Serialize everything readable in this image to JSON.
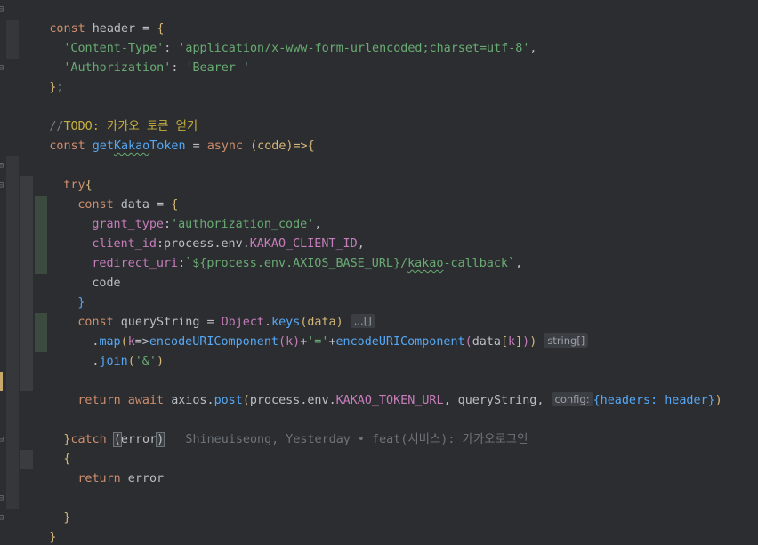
{
  "editor": {
    "lines": {
      "l1": {
        "kw": "const",
        "name": "header",
        "eq": " = ",
        "brace": "{"
      },
      "l2": {
        "key": "'Content-Type'",
        "colon": ": ",
        "val": "'application/x-www-form-urlencoded;charset=utf-8'",
        "comma": ","
      },
      "l3": {
        "key": "'Authorization'",
        "colon": ": ",
        "val": "'Bearer '"
      },
      "l4": {
        "brace": "}",
        "semi": ";"
      },
      "l6": {
        "slashes": "//",
        "todo": "TODO: 카카오 토큰 얻기"
      },
      "l7": {
        "kw": "const",
        "fname_a": "get",
        "fname_b": "Kakao",
        "fname_c": "Token",
        "eq": " = ",
        "async": "async",
        "params": "(code)=>{"
      },
      "l9": {
        "try": "try",
        "brace": "{"
      },
      "l10": {
        "kw": "const",
        "name": " data = ",
        "brace": "{"
      },
      "l11": {
        "key": "grant_type",
        "colon": ":",
        "val": "'authorization_code'",
        "comma": ","
      },
      "l12": {
        "key": "client_id",
        "colon": ":",
        "obj": "process",
        "dot1": ".",
        "env": "env",
        "dot2": ".",
        "constname": "KAKAO_CLIENT_ID",
        "comma": ","
      },
      "l13": {
        "key": "redirect_uri",
        "colon": ":",
        "tpl_open": "`${",
        "obj": "process",
        "dot1": ".",
        "env": "env",
        "dot2": ".",
        "constname": "AXIOS_BASE_URL",
        "tpl_close": "}",
        "slash": "/",
        "kakao": "kakao",
        "rest": "-callback`",
        "comma": ","
      },
      "l14": {
        "key": "code"
      },
      "l15": {
        "brace": "}"
      },
      "l16": {
        "kw": "const",
        "name": " queryString = ",
        "obj": "Object",
        "dot": ".",
        "fn": "keys",
        "args": "(data)",
        "hint": "...[]"
      },
      "l17": {
        "dot": ".",
        "fn": "map",
        "p1": "(",
        "k1": "k",
        "arrow": "=>",
        "enc1": "encodeURIComponent",
        "p2": "(",
        "k2": "k",
        "p3": ")",
        "plus1": "+",
        "eqstr": "'='",
        "plus2": "+",
        "enc2": "encodeURIComponent",
        "p4": "(",
        "data": "data",
        "br1": "[",
        "k3": "k",
        "br2": "]",
        "p5": ")",
        "p6": ")",
        "hint": "string[]"
      },
      "l18": {
        "dot": ".",
        "fn": "join",
        "p1": "(",
        "arg": "'&'",
        "p2": ")"
      },
      "l20": {
        "ret": "return",
        "await": " await ",
        "axios": "axios",
        "dot": ".",
        "fn": "post",
        "p1": "(",
        "obj": "process",
        "dot1": ".",
        "env": "env",
        "dot2": ".",
        "constname": "KAKAO_TOKEN_URL",
        "mid": ", queryString, ",
        "hint": "config:",
        "rest": "{headers: header}",
        "p2": ")"
      },
      "l22": {
        "brace": "}",
        "catch": "catch",
        "sp": " ",
        "p1": "(",
        "err": "error",
        "p2": ")",
        "blame": "   Shineuiseong, Yesterday • feat(서비스): 카카오로그인"
      },
      "l23": {
        "brace": "{"
      },
      "l24": {
        "ret": "return",
        "err": " error"
      },
      "l26": {
        "brace": "}"
      },
      "l27": {
        "brace": "}"
      }
    }
  }
}
